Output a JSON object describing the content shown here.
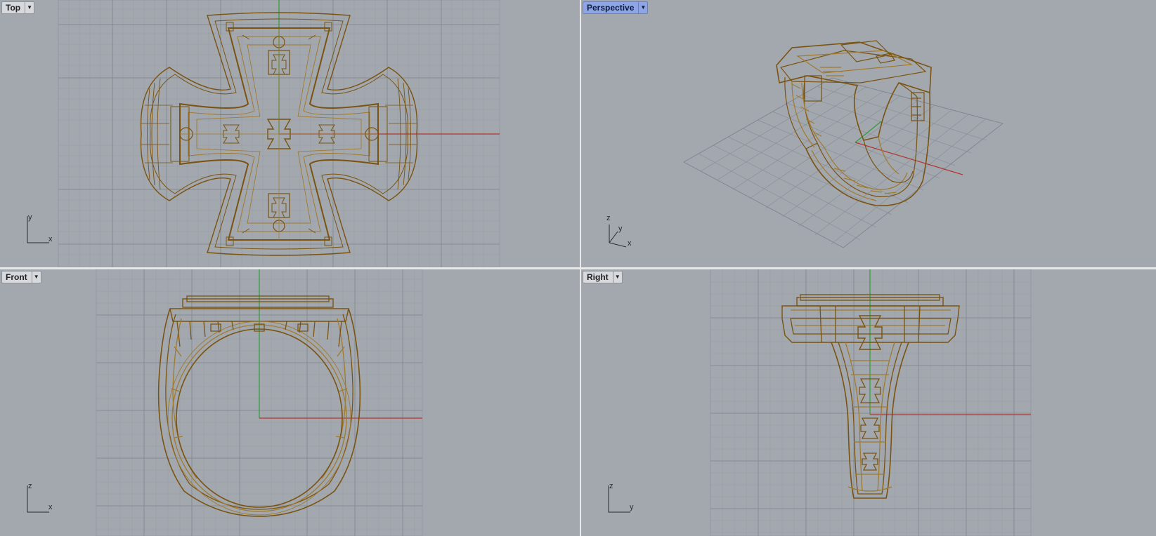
{
  "viewports": {
    "top": {
      "label": "Top",
      "active": false,
      "axes": {
        "h": "x",
        "v": "y"
      }
    },
    "perspective": {
      "label": "Perspective",
      "active": true,
      "axes": {
        "z": "z",
        "y": "y",
        "x": "x"
      }
    },
    "front": {
      "label": "Front",
      "active": false,
      "axes": {
        "h": "x",
        "v": "z"
      }
    },
    "right": {
      "label": "Right",
      "active": false,
      "axes": {
        "h": "y",
        "v": "z"
      }
    }
  },
  "colors": {
    "viewport_bg": "#a3a8af",
    "grid_minor": "#959aa2",
    "grid_major": "#7d838c",
    "axis_x": "#b3352e",
    "axis_y": "#2f9b3a",
    "wire": "#7a5310",
    "wire_light": "#a07a2e",
    "active_tab": "#8ea6e6"
  },
  "dropdown_icon": "triangle-down-icon"
}
